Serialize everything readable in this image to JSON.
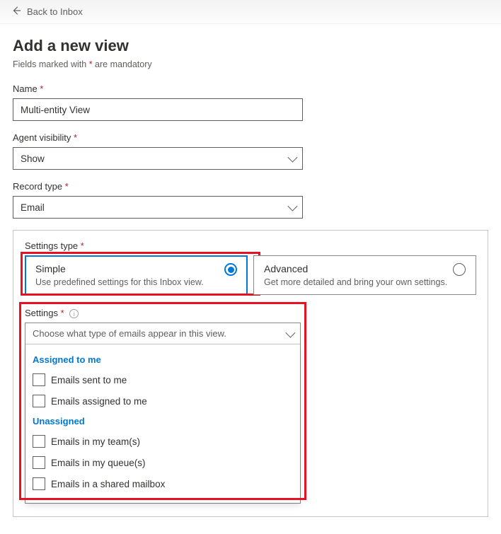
{
  "back_link": "Back to Inbox",
  "page_title": "Add a new view",
  "subtitle_prefix": "Fields marked with ",
  "subtitle_marker": "*",
  "subtitle_suffix": " are mandatory",
  "name": {
    "label": "Name ",
    "value": "Multi-entity View"
  },
  "agent_visibility": {
    "label": "Agent visibility ",
    "value": "Show"
  },
  "record_type": {
    "label": "Record type ",
    "value": "Email"
  },
  "settings_type": {
    "label": "Settings type ",
    "options": {
      "simple": {
        "title": "Simple",
        "desc": "Use predefined settings for this Inbox view."
      },
      "advanced": {
        "title": "Advanced",
        "desc": "Get more detailed and bring your own settings."
      }
    }
  },
  "settings": {
    "label": "Settings ",
    "placeholder": "Choose what type of emails appear in this view.",
    "groups": [
      {
        "header": "Assigned to me",
        "items": [
          "Emails sent to me",
          "Emails assigned to me"
        ]
      },
      {
        "header": "Unassigned",
        "items": [
          "Emails in my team(s)",
          "Emails in my queue(s)",
          "Emails in a shared mailbox"
        ]
      }
    ]
  },
  "star": "*",
  "info_glyph": "i"
}
